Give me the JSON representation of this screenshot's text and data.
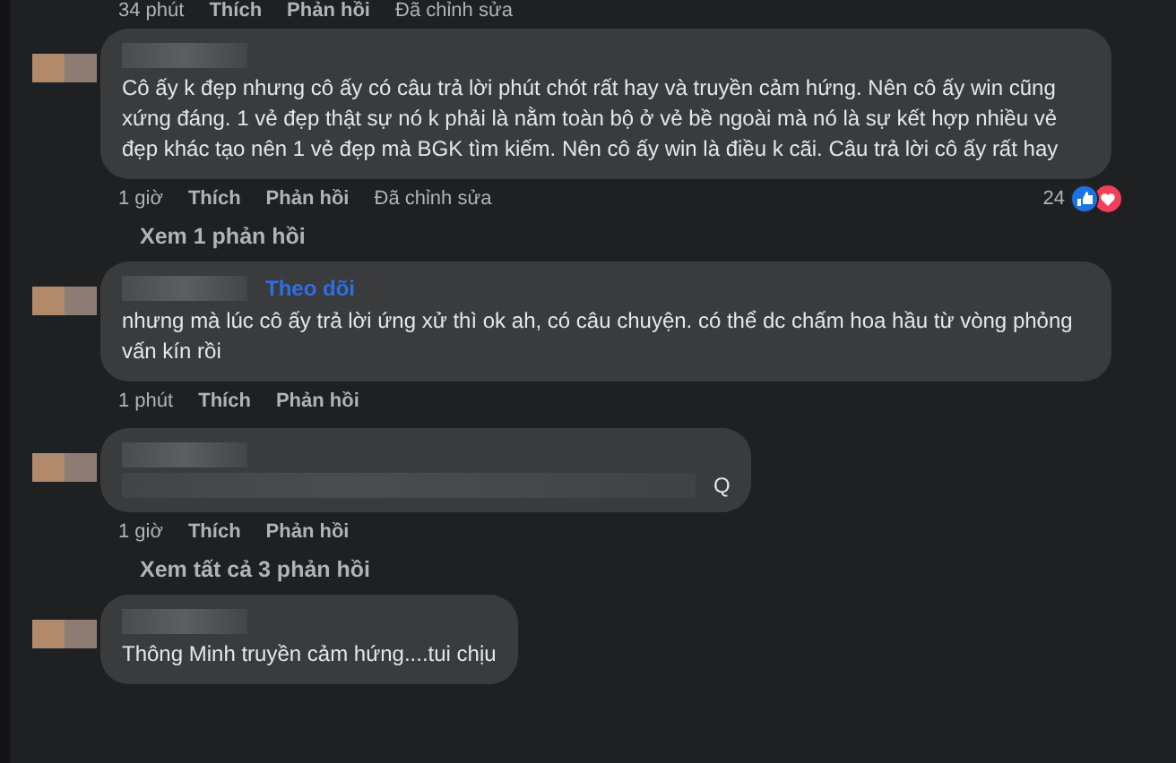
{
  "top_actions": {
    "time": "34 phút",
    "like": "Thích",
    "reply": "Phản hồi",
    "edited": "Đã chỉnh sửa"
  },
  "comments": [
    {
      "kind": "text",
      "text": "Cô ấy k đẹp nhưng cô ấy có câu trả lời phút chót rất hay và truyền cảm hứng. Nên cô ấy win cũng xứng đáng. 1 vẻ đẹp thật sự nó k phải là nằm toàn bộ ở vẻ bề ngoài mà nó là sự kết hợp nhiều vẻ đẹp khác tạo nên 1 vẻ đẹp mà BGK tìm kiếm. Nên cô ấy win là điều k cãi. Câu trả lời cô ấy rất hay",
      "time": "1 giờ",
      "like": "Thích",
      "reply": "Phản hồi",
      "edited": "Đã chỉnh sửa",
      "reaction_count": "24",
      "replies_link": "Xem 1 phản hồi"
    },
    {
      "kind": "text",
      "follow": "Theo dõi",
      "text": "nhưng mà lúc cô ấy trả lời ứng xử thì ok ah, có câu chuyện. có thể dc chấm hoa hầu từ vòng phỏng vấn kín rồi",
      "time": "1 phút",
      "like": "Thích",
      "reply": "Phản hồi"
    },
    {
      "kind": "blurred",
      "trailing": "Q",
      "time": "1 giờ",
      "like": "Thích",
      "reply": "Phản hồi",
      "replies_link": "Xem tất cả 3 phản hồi"
    },
    {
      "kind": "text",
      "text": "Thông Minh truyền cảm hứng....tui chịu"
    }
  ]
}
